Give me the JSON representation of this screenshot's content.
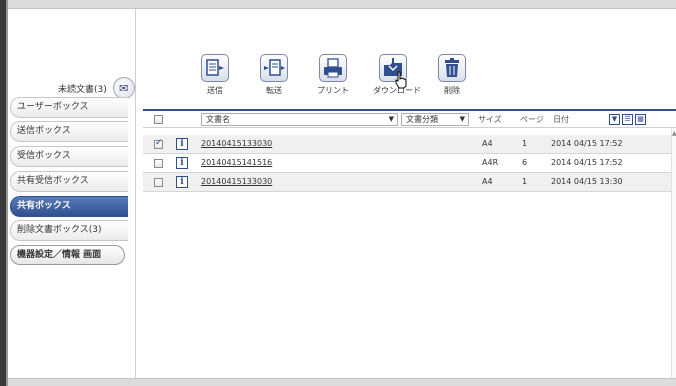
{
  "sidebar": {
    "unread_label": "未読文書(3)",
    "items": [
      {
        "label": "ユーザーボックス",
        "active": false
      },
      {
        "label": "送信ボックス",
        "active": false
      },
      {
        "label": "受信ボックス",
        "active": false
      },
      {
        "label": "共有受信ボックス",
        "active": false
      },
      {
        "label": "共有ボックス",
        "active": true
      },
      {
        "label": "削除文書ボックス(3)",
        "active": false
      }
    ],
    "settings_button": "機器設定／情報 画面"
  },
  "toolbar": {
    "send": "送信",
    "forward": "転送",
    "print": "プリント",
    "download": "ダウンロード",
    "delete": "削除"
  },
  "table": {
    "doc_name_select": "文書名",
    "category_select": "文書分類",
    "col_size": "サイズ",
    "col_pages": "ページ",
    "col_date": "日付",
    "rows": [
      {
        "name": "20140415133030",
        "size": "A4",
        "pages": "1",
        "date": "2014 04/15 17:52",
        "checked": true
      },
      {
        "name": "20140415141516",
        "size": "A4R",
        "pages": "6",
        "date": "2014 04/15 17:52",
        "checked": false
      },
      {
        "name": "20140415133030",
        "size": "A4",
        "pages": "1",
        "date": "2014 04/15 13:30",
        "checked": false
      }
    ]
  },
  "colors": {
    "accent": "#2f4f8f",
    "active_tab": "#3f5f9f",
    "row_alt": "#f0f0f0"
  },
  "icons": [
    "send-icon",
    "forward-icon",
    "print-icon",
    "download-icon",
    "delete-icon",
    "unread-icon",
    "info-icon",
    "list-view-icon",
    "thumbnail-view-icon",
    "dropdown-arrow-icon"
  ]
}
